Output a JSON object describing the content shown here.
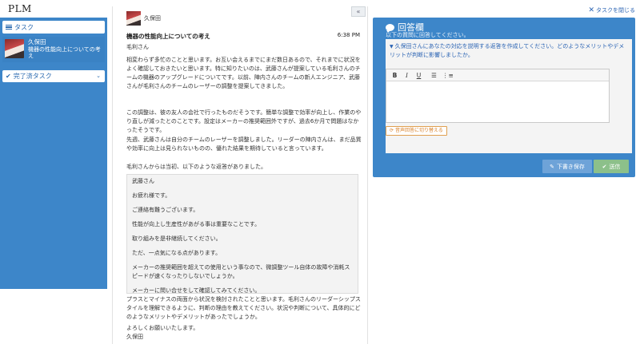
{
  "app": {
    "title": "PLM"
  },
  "header": {
    "close_task_label": "タスクを閉じる"
  },
  "sidebar": {
    "tasks_label": "タスク",
    "task_item": {
      "name": "久保田",
      "subject": "機器の性能向上についての考え"
    },
    "completed_label": "完了済タスク"
  },
  "conversation": {
    "sender": "久保田",
    "subject": "機器の性能向上についての考え",
    "time": "6:38 PM",
    "greeting": "毛利さん",
    "para1": "相変わらず多忙のことと思います。お互い会えるまでにまだ数日あるので、それまでに状況をよく確認しておきたいと思います。特に知りたいのは、武藤さんが提案している毛利さんのチームの機器のアップグレードについてです。以前、陣内さんのチームの新人エンジニア、武藤さんが毛利さんのチームのレーザーの調整を提案してきました。",
    "para2": "この調整は、彼の友人の会社で行ったものだそうです。簡単な調整で効率が向上し、作業のやり直しが減ったとのことです。設定はメーカーの推奨範囲外ですが、過去6か月で問題はなかったそうです。",
    "para3": "先週、武藤さんは自分のチームのレーザーを調整しました。リーダーの陣内さんは、まだ品質や効率に向上は見られないものの、優れた結果を期待していると言っています。",
    "para4": "毛利さんからは当初、以下のような返答がありました。",
    "quote": [
      "武藤さん",
      "お疲れ様です。",
      "ご連絡有難うございます。",
      "性能が向上し生産性があがる事は重要なことです。",
      "取り組みを是非継続してください。",
      "ただ、一点気になる点があります。",
      "メーカーの推奨範囲を超えての使用という事なので、微調整ツール自体の故障や消耗スピードが速くなったりしないでしょうか。",
      "メーカーに問い合せをして確認してみてください。"
    ],
    "para5": "プラスとマイナスの両面から状況を検討されたことと思います。毛利さんのリーダーシップスタイルを理解できるように、判断の理由を教えてください。状況や判断について、具体的にどのようなメリットやデメリットがあったでしょうか。",
    "closing": "よろしくお願いいたします。",
    "signature": "久保田"
  },
  "answer": {
    "title": "回答欄",
    "subtitle": "以下の質問に回答してください。",
    "question": "久保田さんにあなたの対応を説明する返答を作成してください。どのようなメリットやデメリットが判断に影響しましたか。",
    "toolbar": {
      "bold": "B",
      "italic": "I",
      "underline": "U"
    },
    "voice_button": "音声回答に切り替える",
    "save_button": "下書き保存",
    "send_button": "送信"
  },
  "colors": {
    "panel_blue": "#3d86c9",
    "save_blue": "#6ea3d8",
    "send_green": "#8cc08a"
  },
  "icons": [
    "close-icon",
    "list-icon",
    "check-icon",
    "chevron-down-icon",
    "collapse-icon",
    "chat-icon",
    "pencil-icon"
  ]
}
